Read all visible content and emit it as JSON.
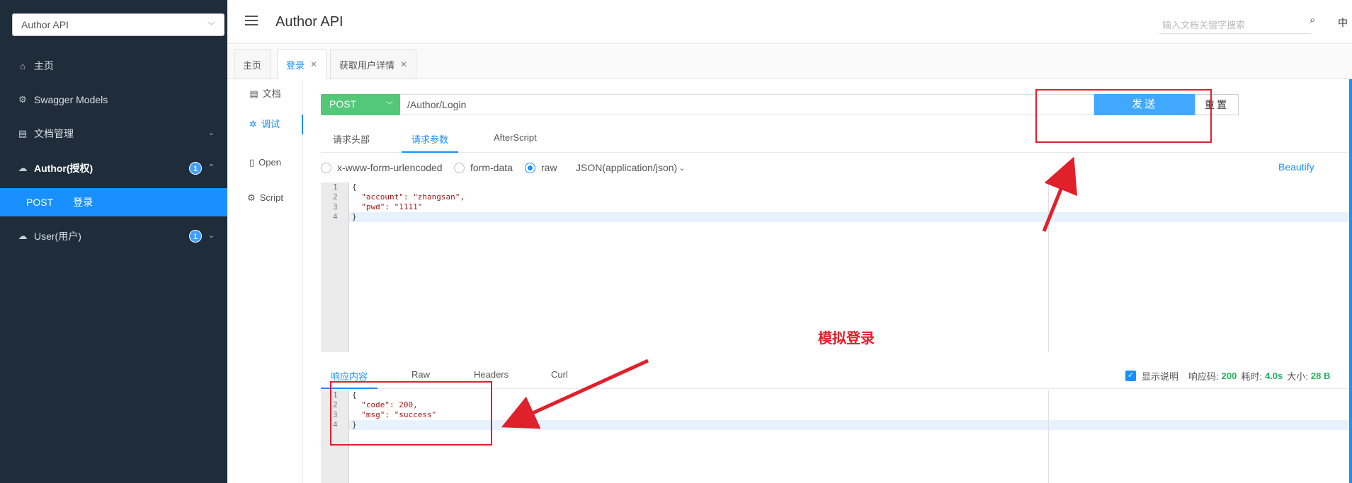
{
  "sidebar": {
    "selector": "Author API",
    "items": [
      {
        "icon": "home-icon",
        "label": "主页"
      },
      {
        "icon": "models-icon",
        "label": "Swagger Models"
      },
      {
        "icon": "doc-icon",
        "label": "文档管理"
      },
      {
        "icon": "cloud-icon",
        "label": "Author(授权)",
        "badge": "1"
      },
      {
        "icon": "cloud-icon",
        "label": "User(用户)",
        "badge": "1"
      }
    ],
    "active": {
      "method": "POST",
      "label": "登录"
    }
  },
  "header": {
    "title": "Author API",
    "search_placeholder": "输入文档关键字搜索",
    "lang": "中"
  },
  "tabs": [
    "主页",
    "登录",
    "获取用户详情"
  ],
  "tools": [
    "文档",
    "调试",
    "Open",
    "Script"
  ],
  "request": {
    "method": "POST",
    "url": "/Author/Login",
    "send_label": "发送",
    "reset_label": "重置",
    "subtabs": [
      "请求头部",
      "请求参数",
      "AfterScript"
    ],
    "body_types": [
      "x-www-form-urlencoded",
      "form-data",
      "raw"
    ],
    "content_type": "JSON(application/json)",
    "beautify": "Beautify",
    "body_lines": [
      "{",
      "  \"account\": \"zhangsan\",",
      "  \"pwd\": \"1111\"",
      "}"
    ]
  },
  "response": {
    "tabs": [
      "响应内容",
      "Raw",
      "Headers",
      "Curl"
    ],
    "show_desc": "显示说明",
    "code_label": "响应码:",
    "code": "200",
    "time_label": "耗时:",
    "time": "4.0s",
    "size_label": "大小:",
    "size": "28 B",
    "body_lines": [
      "{",
      "  \"code\": 200,",
      "  \"msg\": \"success\"",
      "}"
    ]
  },
  "annotation": "模拟登录",
  "colors": {
    "sidebar": "#1f2d3a",
    "active": "#1890ff",
    "method": "#52c878",
    "annotation": "#e0202a"
  }
}
